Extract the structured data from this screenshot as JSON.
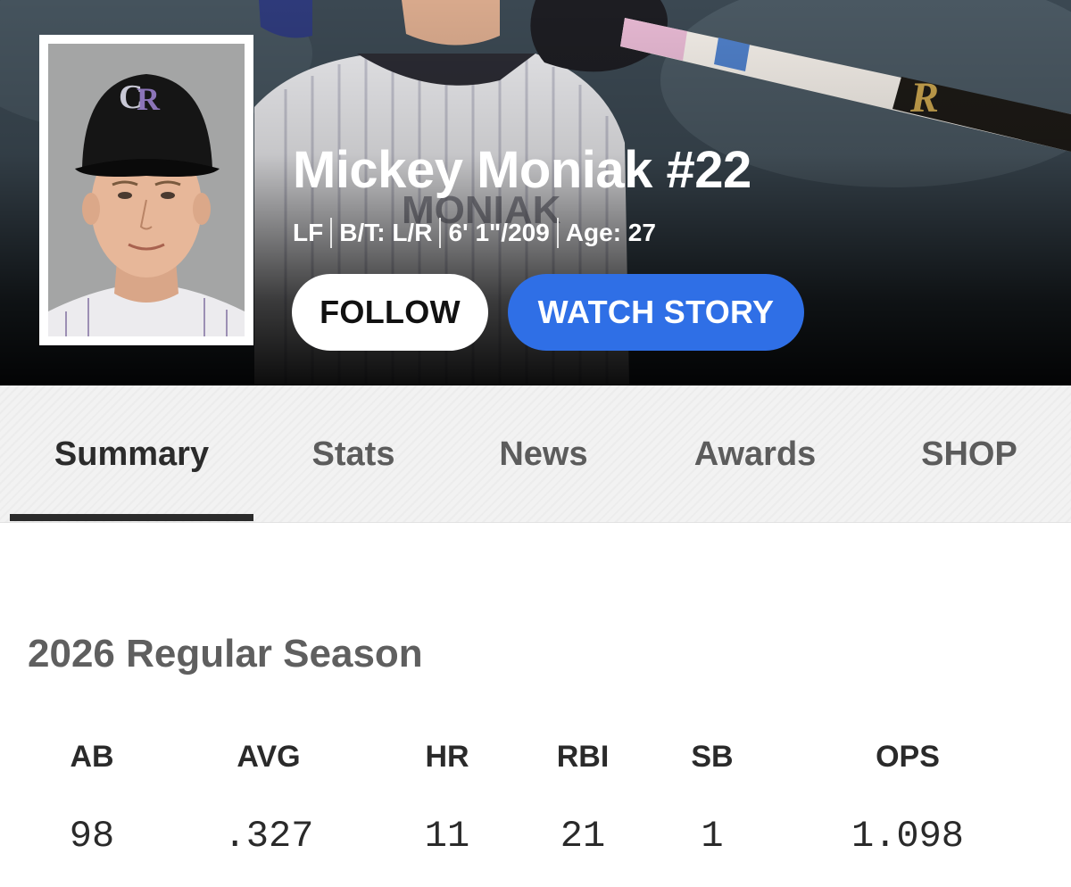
{
  "player": {
    "name": "Mickey Moniak #22",
    "position": "LF",
    "bats_throws": "B/T: L/R",
    "height_weight": "6' 1\"/209",
    "age": "Age: 27"
  },
  "actions": {
    "follow_label": "FOLLOW",
    "watch_story_label": "WATCH STORY"
  },
  "tabs": [
    {
      "label": "Summary",
      "active": true
    },
    {
      "label": "Stats",
      "active": false
    },
    {
      "label": "News",
      "active": false
    },
    {
      "label": "Awards",
      "active": false
    },
    {
      "label": "SHOP",
      "active": false
    }
  ],
  "season": {
    "title": "2026 Regular Season",
    "stats": [
      {
        "label": "AB",
        "value": "98"
      },
      {
        "label": "AVG",
        "value": ".327"
      },
      {
        "label": "HR",
        "value": "11"
      },
      {
        "label": "RBI",
        "value": "21"
      },
      {
        "label": "SB",
        "value": "1"
      },
      {
        "label": "OPS",
        "value": "1.098"
      }
    ]
  },
  "colors": {
    "watch_button": "#2f6fe6",
    "team_purple": "#4b2a7a",
    "tab_underline": "#2b2b2b"
  },
  "icons": {
    "team_logo": "rockies-cr-logo"
  }
}
